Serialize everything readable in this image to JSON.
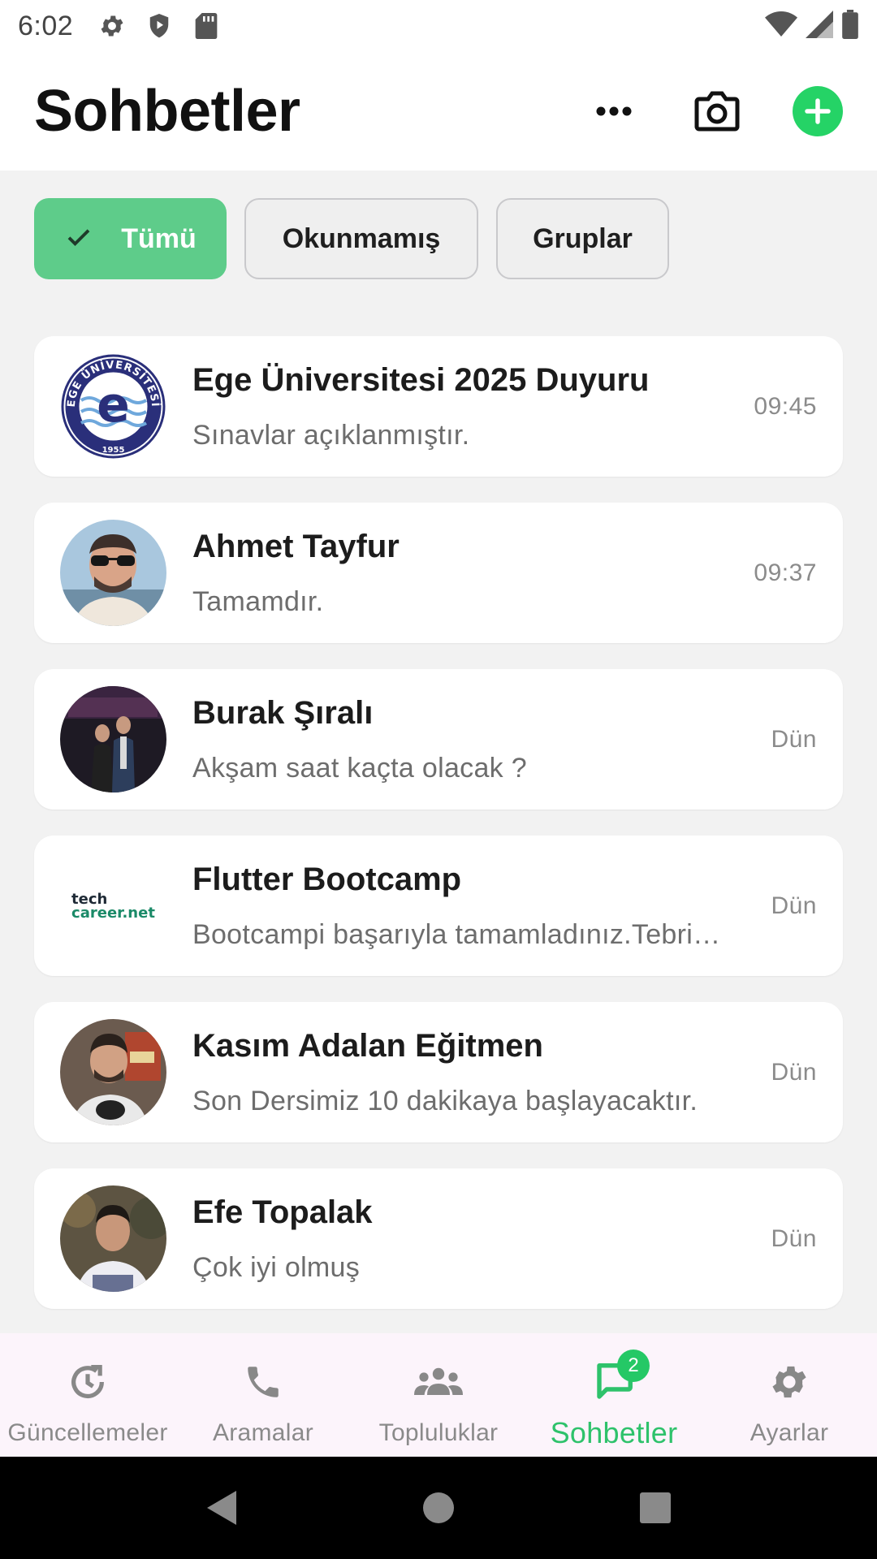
{
  "status_bar": {
    "time": "6:02"
  },
  "header": {
    "title": "Sohbetler"
  },
  "filters": [
    {
      "label": "Tümü",
      "selected": true
    },
    {
      "label": "Okunmamış",
      "selected": false
    },
    {
      "label": "Gruplar",
      "selected": false
    }
  ],
  "chats": [
    {
      "name": "Ege Üniversitesi 2025 Duyuru",
      "message": "Sınavlar açıklanmıştır.",
      "time": "09:45",
      "avatar": "ege-university-logo"
    },
    {
      "name": "Ahmet Tayfur",
      "message": "Tamamdır.",
      "time": "09:37",
      "avatar": "photo"
    },
    {
      "name": "Burak Şıralı",
      "message": "Akşam saat kaçta olacak ?",
      "time": "Dün",
      "avatar": "photo"
    },
    {
      "name": "Flutter Bootcamp",
      "message": "Bootcampi başarıyla tamamladınız.Tebrikler",
      "time": "Dün",
      "avatar": "techcareer-logo"
    },
    {
      "name": "Kasım Adalan Eğitmen",
      "message": "Son Dersimiz 10 dakikaya başlayacaktır.",
      "time": "Dün",
      "avatar": "photo"
    },
    {
      "name": "Efe Topalak",
      "message": "Çok iyi olmuş",
      "time": "Dün",
      "avatar": "photo"
    }
  ],
  "logos": {
    "ege_letter": "e",
    "ege_ring_text": "EGE ÜNİVERSİTESİ",
    "ege_year": "1955",
    "techcareer_line1": "tech",
    "techcareer_line2": "career.net"
  },
  "bottom_nav": {
    "items": [
      {
        "label": "Güncellemeler",
        "icon": "updates-icon",
        "active": false
      },
      {
        "label": "Aramalar",
        "icon": "phone-icon",
        "active": false
      },
      {
        "label": "Topluluklar",
        "icon": "communities-icon",
        "active": false
      },
      {
        "label": "Sohbetler",
        "icon": "chat-icon",
        "active": true,
        "badge": "2"
      },
      {
        "label": "Ayarlar",
        "icon": "settings-icon",
        "active": false
      }
    ]
  },
  "colors": {
    "accent": "#25d366",
    "chip_selected": "#5ecc8a",
    "active_nav": "#2ec26b"
  }
}
